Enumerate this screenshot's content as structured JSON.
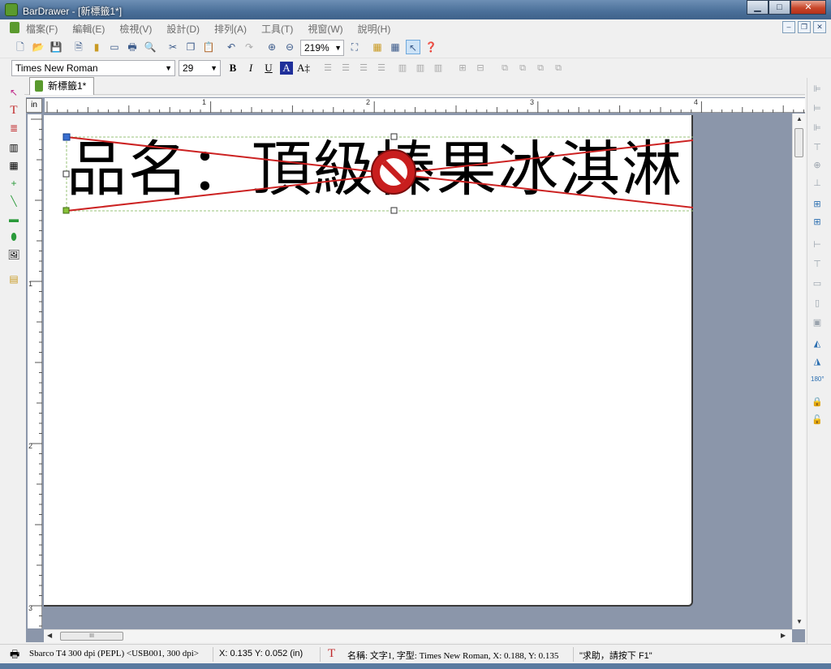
{
  "window": {
    "title": "BarDrawer - [新標籤1*]",
    "minimize_glyph": "▁",
    "maximize_glyph": "□",
    "close_glyph": "✕"
  },
  "mdi": {
    "minimize_glyph": "–",
    "restore_glyph": "❐",
    "close_glyph": "✕"
  },
  "menu": [
    "檔案(F)",
    "編輯(E)",
    "檢視(V)",
    "設計(D)",
    "排列(A)",
    "工具(T)",
    "視窗(W)",
    "說明(H)"
  ],
  "toolbar": {
    "zoom": "219%",
    "icons": [
      "new-doc-icon",
      "open-folder-icon",
      "save-icon",
      "page-setup-icon",
      "database-icon",
      "image-icon",
      "print-icon",
      "print-preview-icon",
      "cut-icon",
      "copy-icon",
      "paste-icon",
      "undo-icon",
      "redo-icon",
      "zoom-in-icon",
      "zoom-out-icon",
      "fit-page-icon",
      "ruler-icon",
      "grid-icon",
      "snap-icon",
      "help-icon"
    ]
  },
  "format": {
    "font": "Times New Roman",
    "size": "29",
    "bold": "B",
    "italic": "I",
    "underline": "U",
    "color": "A",
    "auto_size": "A‡",
    "colors": {
      "color_button": "#1f2f9a"
    }
  },
  "tab": {
    "label": "新標籤1*"
  },
  "ruler": {
    "unit": "in",
    "h_marks": [
      "1",
      "2",
      "3",
      "4"
    ],
    "v_marks": [
      "1",
      "2",
      "3"
    ]
  },
  "label": {
    "text": "品名：頂級榛果冰淇淋"
  },
  "scrollbar": {
    "grip": "III"
  },
  "status": {
    "printer": "Sbarco T4 300 dpi (PEPL) <USB001, 300 dpi>",
    "coords": "X: 0.135  Y: 0.052 (in)",
    "object": "名稱: 文字1, 字型: Times New Roman, X: 0.188, Y: 0.135",
    "help": "\"求助，請按下 F1\""
  },
  "colors": {
    "accent": "#3f628a",
    "selection_line": "#cc2222",
    "handle_green": "#88c23a",
    "no_symbol": "#c81e1e"
  }
}
